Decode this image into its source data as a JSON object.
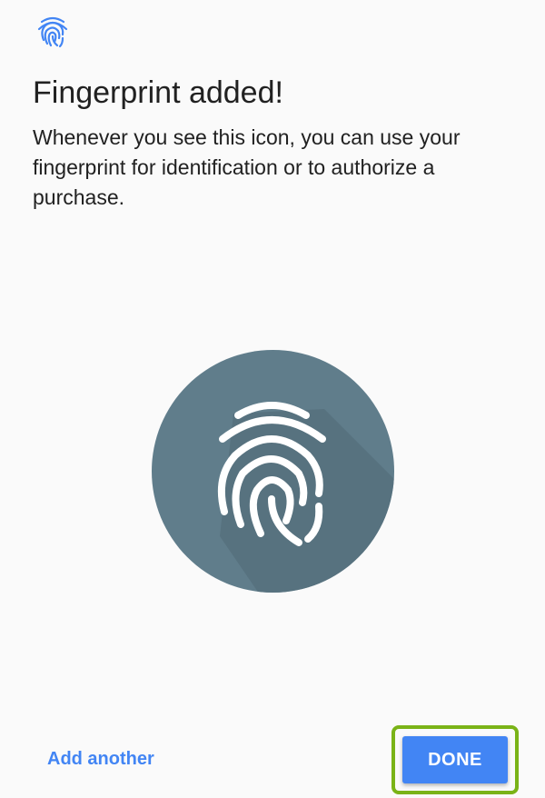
{
  "header": {
    "icon": "fingerprint-icon"
  },
  "content": {
    "title": "Fingerprint added!",
    "description": "Whenever you see this icon, you can use your fingerprint for identification or to authorize a purchase."
  },
  "hero": {
    "icon": "fingerprint-icon",
    "circle_color": "#607d8b",
    "shadow_color": "#546e7a",
    "icon_color": "#ffffff"
  },
  "footer": {
    "secondary_label": "Add another",
    "primary_label": "DONE",
    "accent_color": "#4285f4",
    "highlight_color": "#7ab317"
  }
}
